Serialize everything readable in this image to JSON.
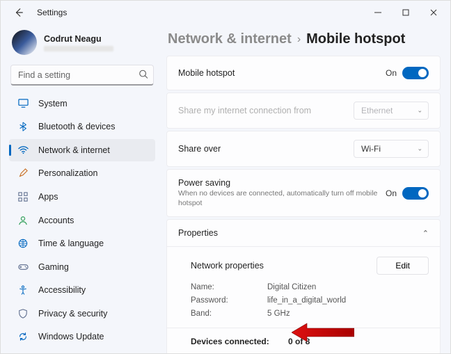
{
  "window": {
    "title": "Settings"
  },
  "user": {
    "name": "Codrut Neagu"
  },
  "search": {
    "placeholder": "Find a setting"
  },
  "sidebar": {
    "items": [
      {
        "label": "System",
        "icon_color": "#0067c0"
      },
      {
        "label": "Bluetooth & devices",
        "icon_color": "#0067c0"
      },
      {
        "label": "Network & internet",
        "icon_color": "#0067c0"
      },
      {
        "label": "Personalization",
        "icon_color": "#c76a1e"
      },
      {
        "label": "Apps",
        "icon_color": "#5b6b8c"
      },
      {
        "label": "Accounts",
        "icon_color": "#2f9e58"
      },
      {
        "label": "Time & language",
        "icon_color": "#0067c0"
      },
      {
        "label": "Gaming",
        "icon_color": "#5b6b8c"
      },
      {
        "label": "Accessibility",
        "icon_color": "#0067c0"
      },
      {
        "label": "Privacy & security",
        "icon_color": "#5b6b8c"
      },
      {
        "label": "Windows Update",
        "icon_color": "#0067c0"
      }
    ],
    "active_index": 2
  },
  "breadcrumb": {
    "parent": "Network & internet",
    "current": "Mobile hotspot"
  },
  "cards": {
    "hotspot": {
      "label": "Mobile hotspot",
      "state": "On"
    },
    "share_from": {
      "label": "Share my internet connection from",
      "value": "Ethernet"
    },
    "share_over": {
      "label": "Share over",
      "value": "Wi-Fi"
    },
    "power_saving": {
      "label": "Power saving",
      "sub": "When no devices are connected, automatically turn off mobile hotspot",
      "state": "On"
    }
  },
  "properties": {
    "title": "Properties",
    "section_title": "Network properties",
    "edit_label": "Edit",
    "name_label": "Name:",
    "name_value": "Digital Citizen",
    "password_label": "Password:",
    "password_value": "life_in_a_digital_world",
    "band_label": "Band:",
    "band_value": "5 GHz",
    "devices_label": "Devices connected:",
    "devices_value": "0 of 8"
  },
  "callout": {
    "arrow_color": "#e11b1b"
  }
}
